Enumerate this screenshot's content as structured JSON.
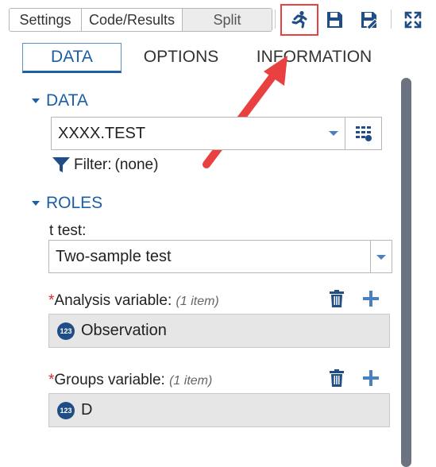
{
  "view_toggle": {
    "settings": "Settings",
    "code_results": "Code/Results",
    "split": "Split"
  },
  "toolbar": {
    "icons": [
      "run-icon",
      "save-icon",
      "save-as-icon",
      "expand-icon"
    ]
  },
  "tabs": [
    {
      "label": "DATA",
      "active": true
    },
    {
      "label": "OPTIONS",
      "active": false
    },
    {
      "label": "INFORMATION",
      "active": false
    }
  ],
  "data_section": {
    "heading": "DATA",
    "dataset_value": "XXXX.TEST",
    "filter_label": "Filter:",
    "filter_value": "(none)"
  },
  "roles_section": {
    "heading": "ROLES",
    "ttest_label": "t test:",
    "ttest_value": "Two-sample test",
    "analysis": {
      "required": "*",
      "label": "Analysis variable:",
      "count": "(1 item)",
      "items": [
        {
          "badge": "123",
          "name": "Observation"
        }
      ]
    },
    "groups": {
      "required": "*",
      "label": "Groups variable:",
      "count": "(1 item)",
      "items": [
        {
          "badge": "123",
          "name": "D"
        }
      ]
    }
  },
  "colors": {
    "accent": "#1a5fa8",
    "highlight": "#e8413f",
    "badge": "#1f4d86"
  }
}
